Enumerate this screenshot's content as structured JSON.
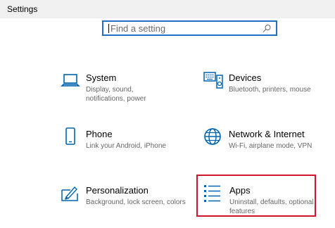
{
  "window": {
    "title": "Settings"
  },
  "search": {
    "placeholder": "Find a setting"
  },
  "tiles": [
    {
      "name": "System",
      "desc": "Display, sound, notifications, power",
      "icon": "laptop-icon"
    },
    {
      "name": "Devices",
      "desc": "Bluetooth, printers, mouse",
      "icon": "keyboard-speaker-icon"
    },
    {
      "name": "Phone",
      "desc": "Link your Android, iPhone",
      "icon": "phone-icon"
    },
    {
      "name": "Network & Internet",
      "desc": "Wi-Fi, airplane mode, VPN",
      "icon": "globe-icon"
    },
    {
      "name": "Personalization",
      "desc": "Background, lock screen, colors",
      "icon": "paint-tablet-icon"
    },
    {
      "name": "Apps",
      "desc": "Uninstall, defaults, optional features",
      "icon": "apps-list-icon"
    }
  ],
  "colors": {
    "accent": "#0063b1",
    "highlight": "#d0142c"
  }
}
